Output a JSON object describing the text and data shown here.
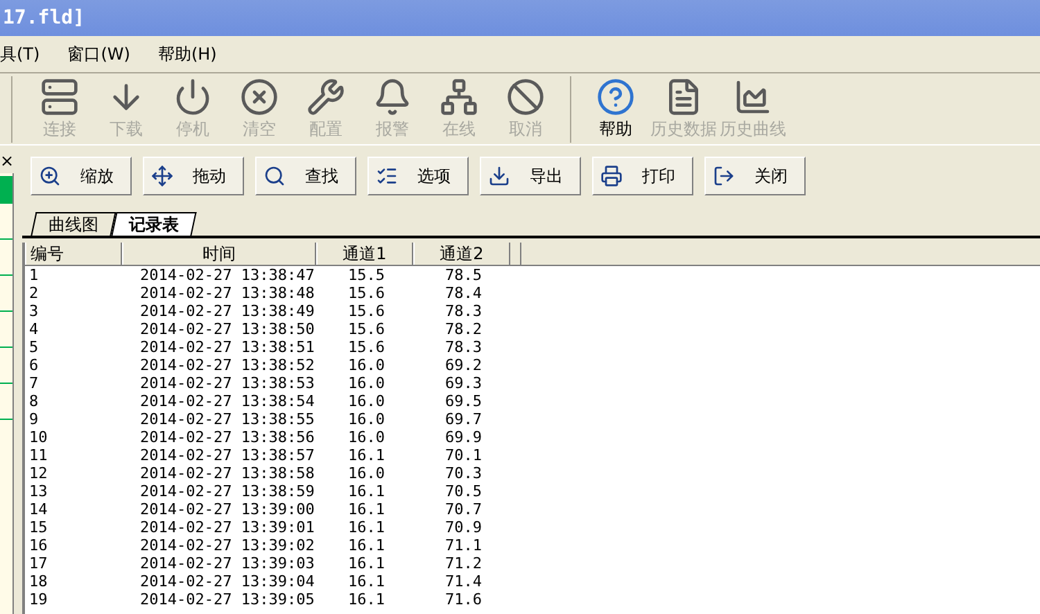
{
  "window": {
    "title": "17.fld]"
  },
  "menu": [
    "具(T)",
    "窗口(W)",
    "帮助(H)"
  ],
  "toolbar": [
    {
      "kind": "tool",
      "label": "连接",
      "enabled": false
    },
    {
      "kind": "tool",
      "label": "下载",
      "enabled": false
    },
    {
      "kind": "tool",
      "label": "停机",
      "enabled": false
    },
    {
      "kind": "tool",
      "label": "清空",
      "enabled": false
    },
    {
      "kind": "tool",
      "label": "配置",
      "enabled": false
    },
    {
      "kind": "tool",
      "label": "报警",
      "enabled": false
    },
    {
      "kind": "tool",
      "label": "在线",
      "enabled": false
    },
    {
      "kind": "tool",
      "label": "取消",
      "enabled": false
    },
    {
      "kind": "separator"
    },
    {
      "kind": "tool",
      "label": "帮助",
      "enabled": true
    },
    {
      "kind": "tool",
      "label": "历史数据",
      "enabled": false
    },
    {
      "kind": "tool",
      "label": "历史曲线",
      "enabled": false
    }
  ],
  "side_panel": {
    "close": "×"
  },
  "buttons": [
    "缩放",
    "拖动",
    "查找",
    "选项",
    "导出",
    "打印",
    "关闭"
  ],
  "tabs": [
    {
      "label": "曲线图",
      "selected": false
    },
    {
      "label": "记录表",
      "selected": true
    }
  ],
  "table": {
    "columns": [
      "编号",
      "时间",
      "通道1",
      "通道2"
    ],
    "rows": [
      [
        "1",
        "2014-02-27 13:38:47",
        "15.5",
        "78.5"
      ],
      [
        "2",
        "2014-02-27 13:38:48",
        "15.6",
        "78.4"
      ],
      [
        "3",
        "2014-02-27 13:38:49",
        "15.6",
        "78.3"
      ],
      [
        "4",
        "2014-02-27 13:38:50",
        "15.6",
        "78.2"
      ],
      [
        "5",
        "2014-02-27 13:38:51",
        "15.6",
        "78.3"
      ],
      [
        "6",
        "2014-02-27 13:38:52",
        "16.0",
        "69.2"
      ],
      [
        "7",
        "2014-02-27 13:38:53",
        "16.0",
        "69.3"
      ],
      [
        "8",
        "2014-02-27 13:38:54",
        "16.0",
        "69.5"
      ],
      [
        "9",
        "2014-02-27 13:38:55",
        "16.0",
        "69.7"
      ],
      [
        "10",
        "2014-02-27 13:38:56",
        "16.0",
        "69.9"
      ],
      [
        "11",
        "2014-02-27 13:38:57",
        "16.1",
        "70.1"
      ],
      [
        "12",
        "2014-02-27 13:38:58",
        "16.0",
        "70.3"
      ],
      [
        "13",
        "2014-02-27 13:38:59",
        "16.1",
        "70.5"
      ],
      [
        "14",
        "2014-02-27 13:39:00",
        "16.1",
        "70.7"
      ],
      [
        "15",
        "2014-02-27 13:39:01",
        "16.1",
        "70.9"
      ],
      [
        "16",
        "2014-02-27 13:39:02",
        "16.1",
        "71.1"
      ],
      [
        "17",
        "2014-02-27 13:39:03",
        "16.1",
        "71.2"
      ],
      [
        "18",
        "2014-02-27 13:39:04",
        "16.1",
        "71.4"
      ],
      [
        "19",
        "2014-02-27 13:39:05",
        "16.1",
        "71.6"
      ]
    ]
  }
}
